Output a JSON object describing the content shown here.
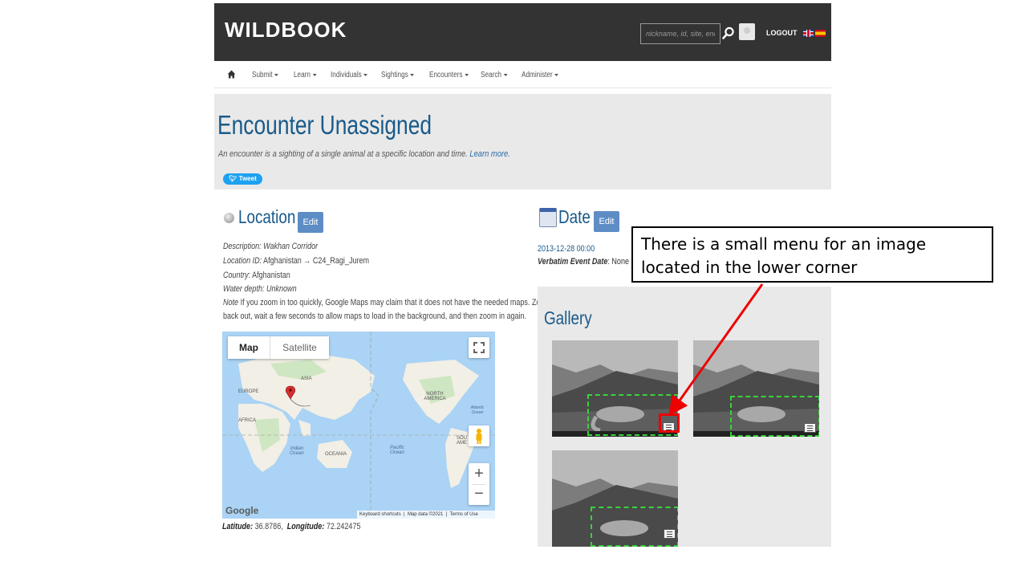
{
  "header": {
    "logo": "WILDBOOK",
    "search_placeholder": "nickname, id, site, encou",
    "logout": "LOGOUT"
  },
  "nav": {
    "items": [
      "Submit",
      "Learn",
      "Individuals",
      "Sightings",
      "Encounters",
      "Search",
      "Administer"
    ]
  },
  "hero": {
    "title": "Encounter Unassigned",
    "subtitle": "An encounter is a sighting of a single animal at a specific location and time.",
    "learn_more": "Learn more.",
    "tweet": "Tweet"
  },
  "location": {
    "title": "Location",
    "edit": "Edit",
    "description_label": "Description:",
    "description_value": "Wakhan Corridor",
    "location_id_label": "Location ID:",
    "location_id_value": "Afghanistan → C24_Ragi_Jurem",
    "country_label": "Country",
    "country_value": "Afghanistan",
    "water_depth": "Water depth: Unknown",
    "note_label": "Note",
    "note_line1": "If you zoom in too quickly, Google Maps may claim that it does not have the needed maps. Zoom",
    "note_line2": "back out, wait a few seconds to allow maps to load in the background, and then zoom in again.",
    "latitude_label": "Latitude:",
    "latitude_value": "36.8786",
    "longitude_label": "Longitude:",
    "longitude_value": "72.242475"
  },
  "map": {
    "tab_map": "Map",
    "tab_satellite": "Satellite",
    "google": "Google",
    "footer_shortcuts": "Keyboard shortcuts",
    "footer_data": "Map data ©2021",
    "footer_terms": "Terms of Use",
    "labels": {
      "asia": "ASIA",
      "europe": "EUROPE",
      "africa": "AFRICA",
      "north_america": "NORTH AMERICA",
      "oceania": "OCEANIA",
      "indian_ocean": "Indian Ocean",
      "pacific_ocean": "Pacific Ocean",
      "atlantic_ocean": "Atlantic Ocean",
      "south_america": "SOU AME"
    }
  },
  "date": {
    "title": "Date",
    "edit": "Edit",
    "value": "2013-12-28 00:00",
    "verbatim_label": "Verbatim Event Date",
    "verbatim_value": "None"
  },
  "gallery": {
    "title": "Gallery"
  },
  "annotation": {
    "text": "There is a small menu for an image located in the lower corner",
    "color": "#e00000"
  },
  "colors": {
    "header_bg": "#333333",
    "title_blue": "#1a5a8a",
    "edit_button": "#5e8dc5",
    "bbox_green": "#39d23a"
  }
}
